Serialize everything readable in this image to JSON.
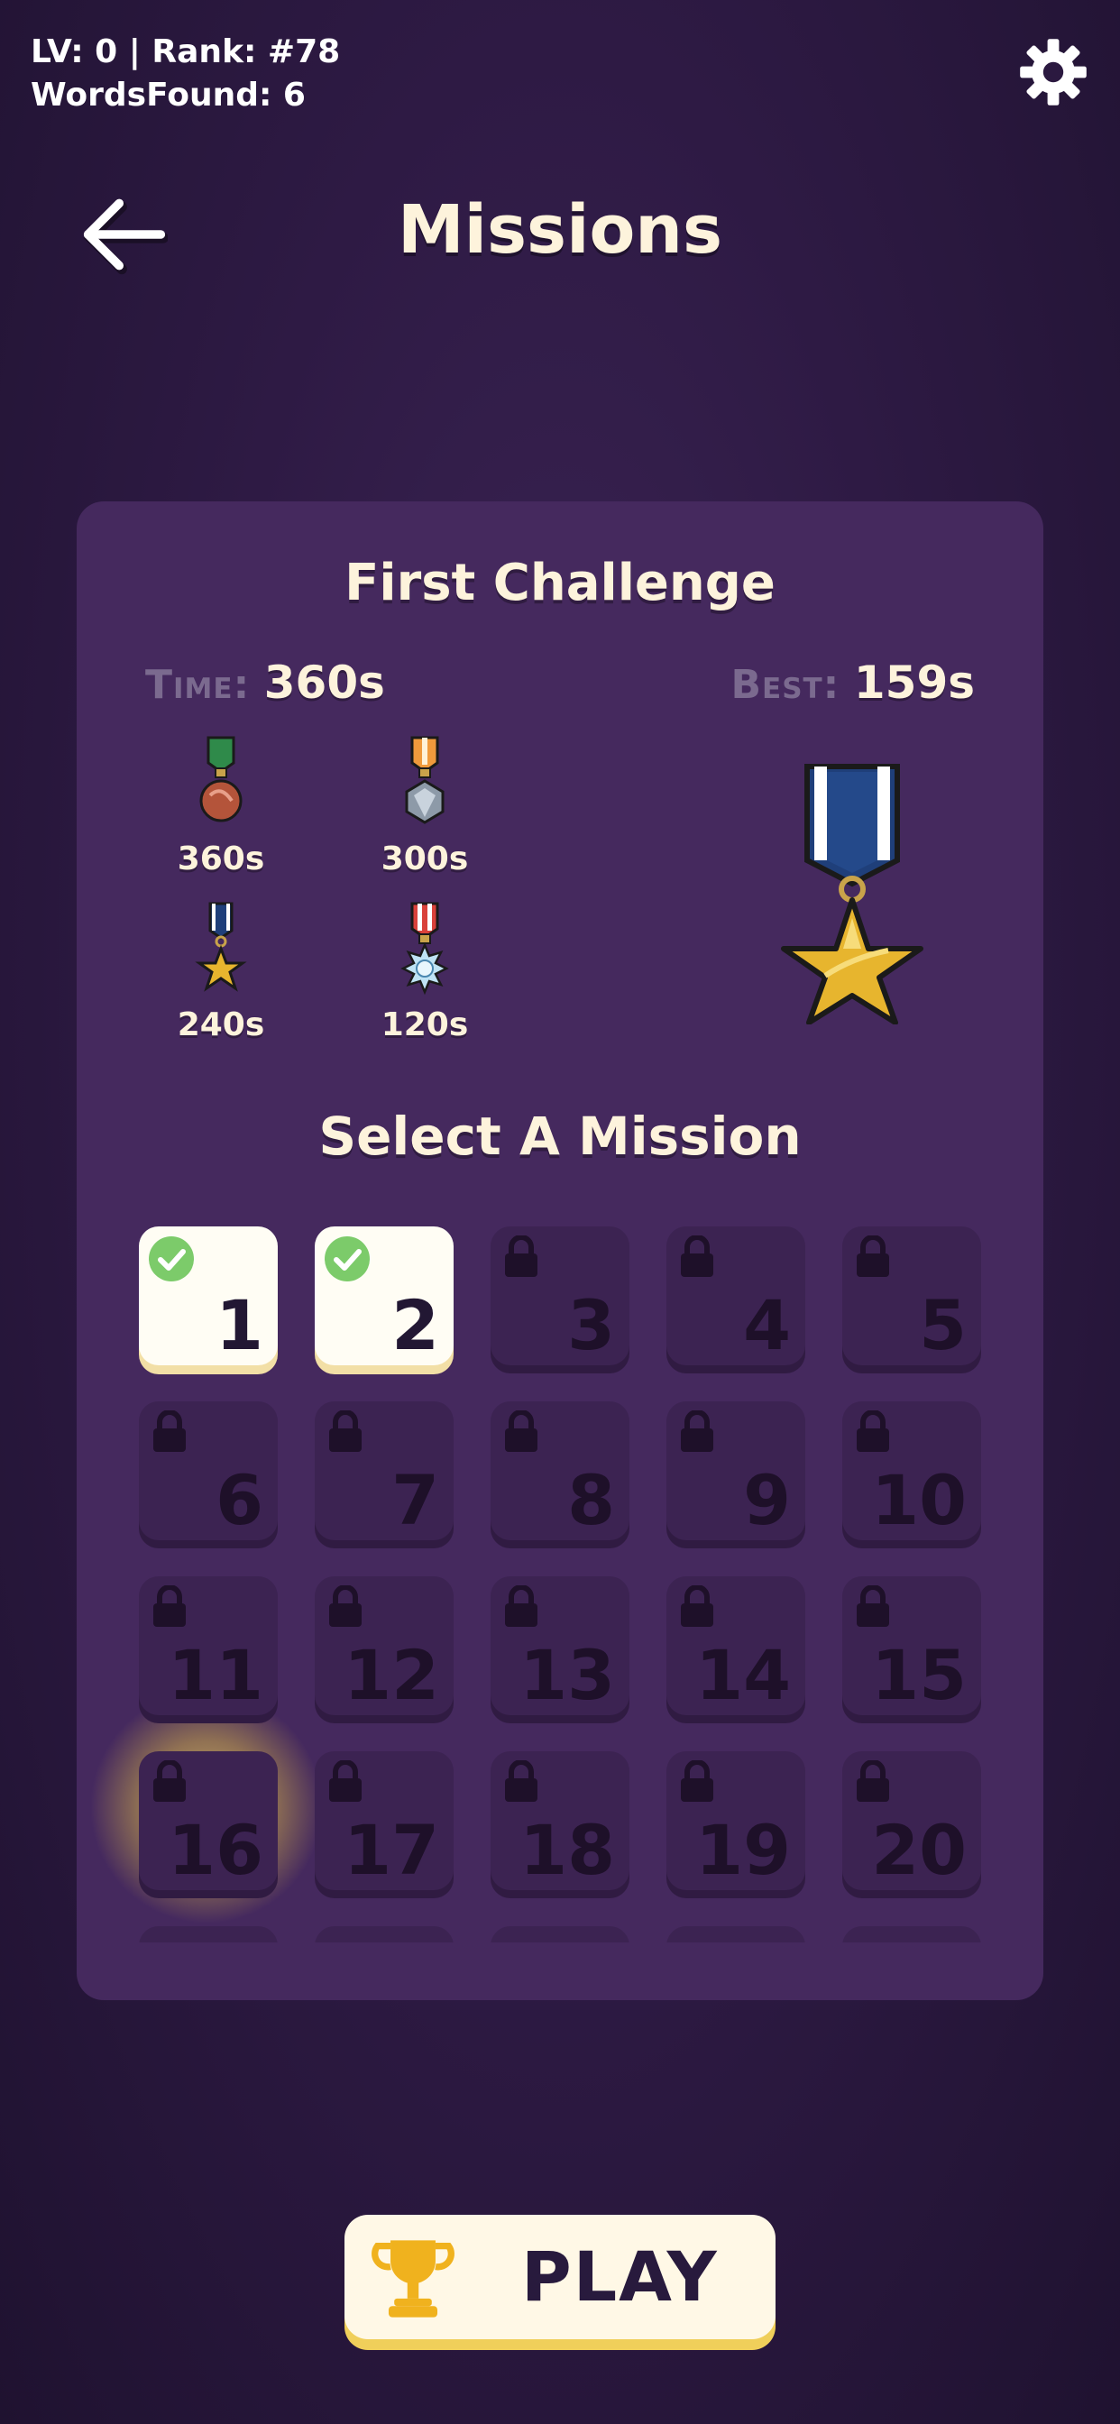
{
  "header": {
    "stats_line1": "LV: 0 | Rank: #78",
    "stats_line2": "WordsFound: 6",
    "title": "Missions"
  },
  "challenge": {
    "title": "First Challenge",
    "time_label": "Time:",
    "time_value": "360s",
    "best_label": "Best:",
    "best_value": "159s",
    "medals": [
      {
        "label": "360s",
        "icon": "bronze-medal-icon"
      },
      {
        "label": "300s",
        "icon": "silver-medal-icon"
      },
      {
        "label": "240s",
        "icon": "gold-star-medal-icon"
      },
      {
        "label": "120s",
        "icon": "platinum-medal-icon"
      }
    ],
    "best_medal_icon": "gold-star-medal-icon"
  },
  "missions": {
    "title": "Select A Mission",
    "tiles": [
      {
        "num": "1",
        "state": "completed",
        "selected": true
      },
      {
        "num": "2",
        "state": "completed"
      },
      {
        "num": "3",
        "state": "locked"
      },
      {
        "num": "4",
        "state": "locked"
      },
      {
        "num": "5",
        "state": "locked"
      },
      {
        "num": "6",
        "state": "locked"
      },
      {
        "num": "7",
        "state": "locked"
      },
      {
        "num": "8",
        "state": "locked"
      },
      {
        "num": "9",
        "state": "locked"
      },
      {
        "num": "10",
        "state": "locked"
      },
      {
        "num": "11",
        "state": "locked"
      },
      {
        "num": "12",
        "state": "locked"
      },
      {
        "num": "13",
        "state": "locked"
      },
      {
        "num": "14",
        "state": "locked"
      },
      {
        "num": "15",
        "state": "locked"
      },
      {
        "num": "16",
        "state": "locked"
      },
      {
        "num": "17",
        "state": "locked"
      },
      {
        "num": "18",
        "state": "locked"
      },
      {
        "num": "19",
        "state": "locked"
      },
      {
        "num": "20",
        "state": "locked"
      }
    ]
  },
  "play_button": {
    "label": "PLAY",
    "icon": "trophy-icon"
  },
  "colors": {
    "background": "#2e1a44",
    "panel": "#45295e",
    "locked_tile": "#3c2352",
    "unlocked_tile": "#fffdf4",
    "check_green": "#7ccb6a",
    "accent_gold": "#f0cf5a"
  }
}
